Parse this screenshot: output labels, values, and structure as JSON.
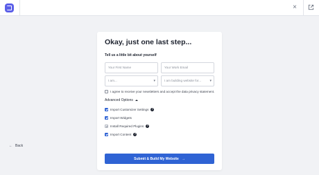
{
  "header": {
    "close_glyph": "×",
    "logo_icon": "brand-logo-icon",
    "close_icon": "close-icon",
    "external_icon": "external-link-icon"
  },
  "form": {
    "title": "Okay, just one last step...",
    "subtitle": "Tell us a little bit about yourself",
    "first_name_placeholder": "Your First Name",
    "email_placeholder": "Your Work Email",
    "role_select_value": "I am...",
    "site_select_value": "I am building website for...",
    "select_caret": "▾",
    "newsletter_label": "I agree to receive your newsletters and accept the data privacy statement.",
    "newsletter_checked": false,
    "advanced_label": "Advanced Options",
    "advanced_expanded": true,
    "options": [
      {
        "label": "Import Customizer Settings",
        "checked": true,
        "help": true
      },
      {
        "label": "Import Widgets",
        "checked": true,
        "help": false
      },
      {
        "label": "Install Required Plugins",
        "checked": true,
        "disabled": true,
        "help": true
      },
      {
        "label": "Import Content",
        "checked": true,
        "help": true
      }
    ],
    "help_glyph": "?",
    "submit_label": "Submit & Build My Website",
    "submit_arrow": "→"
  },
  "footer": {
    "back_arrow": "←",
    "back_label": "Back"
  },
  "colors": {
    "accent": "#2f63d4",
    "brand": "#5b5fe8",
    "background": "#f1f2f5"
  }
}
